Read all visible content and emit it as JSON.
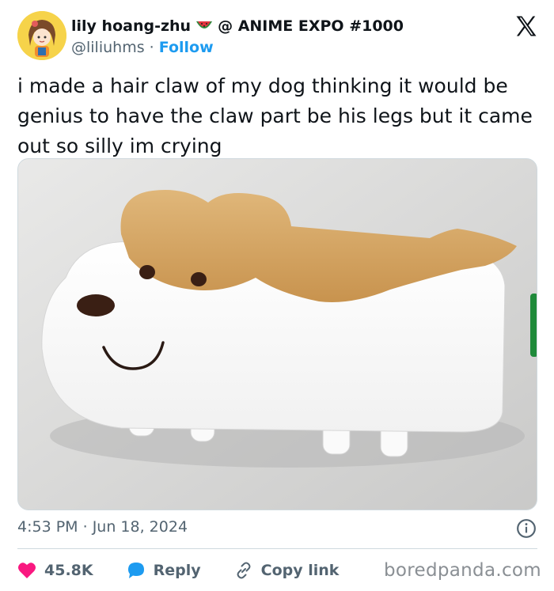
{
  "author": {
    "display_name": "lily hoang-zhu",
    "emoji_icon": "watermelon-icon",
    "event_tag": "@ ANIME EXPO #1000",
    "handle": "@liliuhms",
    "separator": "·",
    "follow_label": "Follow",
    "avatar_icon": "avatar-illustration"
  },
  "tweet": {
    "text": "i made a hair claw of my dog thinking it would be genius to have the claw part be his legs but it came out so silly im crying",
    "media_icon": "dog-hair-claw-photo"
  },
  "meta": {
    "time": "4:53 PM",
    "separator": "·",
    "date": "Jun 18, 2024",
    "info_icon": "info-icon"
  },
  "actions": {
    "likes_count": "45.8K",
    "reply_label": "Reply",
    "copy_link_label": "Copy link"
  },
  "watermark": "boredpanda.com",
  "colors": {
    "accent": "#1d9bf0",
    "like": "#f91880",
    "muted": "#536471",
    "text": "#0f1419"
  }
}
